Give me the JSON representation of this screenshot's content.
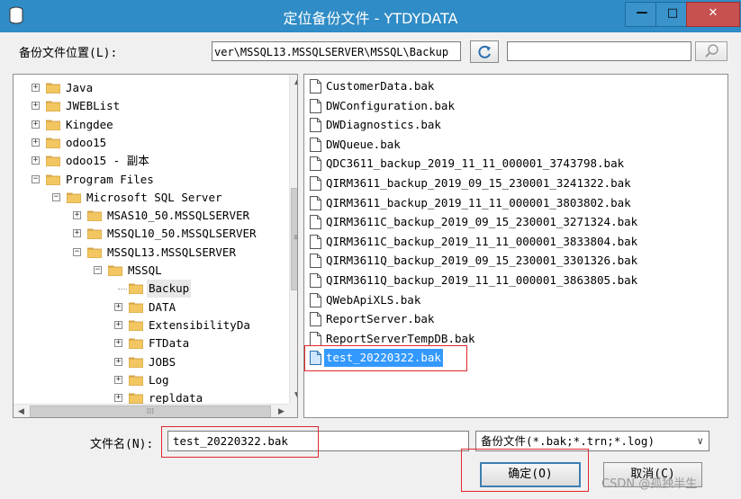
{
  "window": {
    "title": "定位备份文件 - YTDYDATA",
    "minimize_glyph": "—",
    "maximize_glyph": "□",
    "close_glyph": "✕"
  },
  "location": {
    "label": "备份文件位置(L):",
    "path": "ver\\MSSQL13.MSSQLSERVER\\MSSQL\\Backup",
    "search_value": ""
  },
  "tree": {
    "items": [
      {
        "label": "Java",
        "expander": "+"
      },
      {
        "label": "JWEBList",
        "expander": "+"
      },
      {
        "label": "Kingdee",
        "expander": "+"
      },
      {
        "label": "odoo15",
        "expander": "+"
      },
      {
        "label": "odoo15 - 副本",
        "expander": "+"
      },
      {
        "label": "Program Files",
        "expander": "−"
      },
      {
        "label": "Microsoft SQL Server",
        "expander": "−"
      },
      {
        "label": "MSAS10_50.MSSQLSERVER",
        "expander": "+"
      },
      {
        "label": "MSSQL10_50.MSSQLSERVER",
        "expander": "+"
      },
      {
        "label": "MSSQL13.MSSQLSERVER",
        "expander": "−"
      },
      {
        "label": "MSSQL",
        "expander": "−"
      },
      {
        "label": "Backup",
        "expander": ""
      },
      {
        "label": "DATA",
        "expander": "+"
      },
      {
        "label": "ExtensibilityDa",
        "expander": "+"
      },
      {
        "label": "FTData",
        "expander": "+"
      },
      {
        "label": "JOBS",
        "expander": "+"
      },
      {
        "label": "Log",
        "expander": "+"
      },
      {
        "label": "repldata",
        "expander": "+"
      }
    ],
    "selected": "Backup"
  },
  "files": {
    "items": [
      "CustomerData.bak",
      "DWConfiguration.bak",
      "DWDiagnostics.bak",
      "DWQueue.bak",
      "QDC3611_backup_2019_11_11_000001_3743798.bak",
      "QIRM3611_backup_2019_09_15_230001_3241322.bak",
      "QIRM3611_backup_2019_11_11_000001_3803802.bak",
      "QIRM3611C_backup_2019_09_15_230001_3271324.bak",
      "QIRM3611C_backup_2019_11_11_000001_3833804.bak",
      "QIRM3611Q_backup_2019_09_15_230001_3301326.bak",
      "QIRM3611Q_backup_2019_11_11_000001_3863805.bak",
      "QWebApiXLS.bak",
      "ReportServer.bak",
      "ReportServerTempDB.bak",
      "test_20220322.bak"
    ],
    "selected": "test_20220322.bak"
  },
  "filename": {
    "label": "文件名(N):",
    "value": "test_20220322.bak"
  },
  "filetype": {
    "value": "备份文件(*.bak;*.trn;*.log)"
  },
  "buttons": {
    "ok": "确定(O)",
    "cancel": "取消(C)"
  },
  "watermark": "CSDN @孤独半生",
  "colors": {
    "titlebar": "#2f8cc6",
    "selection": "#3399ff",
    "highlight_box": "#e0262c"
  }
}
